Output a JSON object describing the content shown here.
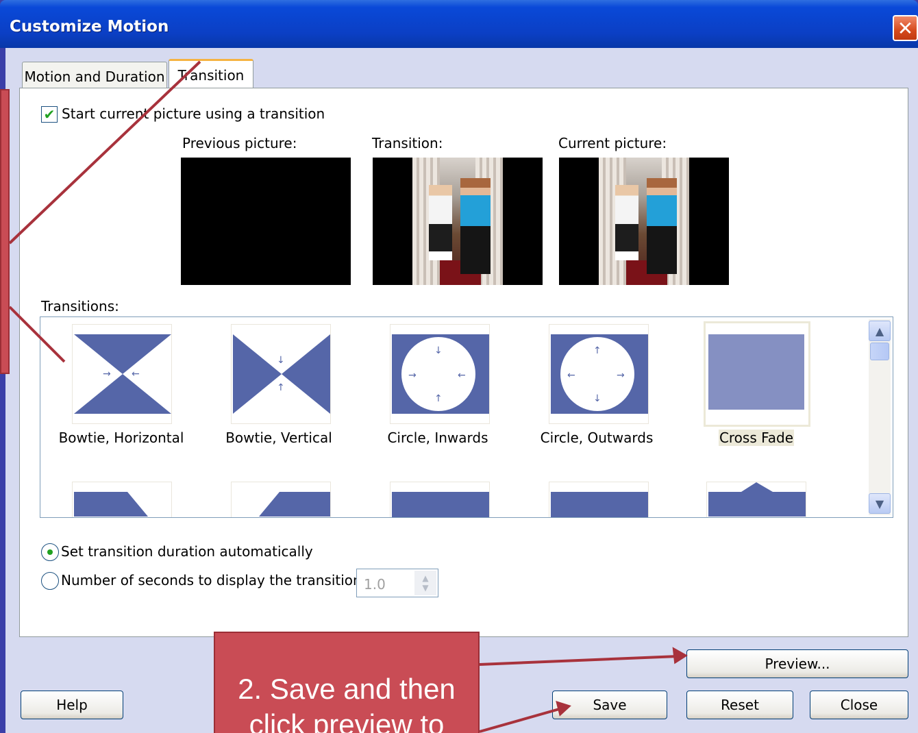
{
  "window": {
    "title": "Customize Motion",
    "close_glyph": "✕"
  },
  "tabs": [
    {
      "label": "Motion and Duration",
      "selected": false
    },
    {
      "label": "Transition",
      "selected": true
    }
  ],
  "transition_panel": {
    "start_checkbox_label": "Start current picture using a transition",
    "start_checkbox_checked": true,
    "previews": {
      "previous_label": "Previous picture:",
      "transition_label": "Transition:",
      "current_label": "Current picture:"
    },
    "transitions_label": "Transitions:",
    "transitions": [
      {
        "label": "Bowtie, Horizontal",
        "icon": "bowtie-horizontal-icon"
      },
      {
        "label": "Bowtie, Vertical",
        "icon": "bowtie-vertical-icon"
      },
      {
        "label": "Circle, Inwards",
        "icon": "circle-inwards-icon"
      },
      {
        "label": "Circle, Outwards",
        "icon": "circle-outwards-icon"
      },
      {
        "label": "Cross Fade",
        "icon": "cross-fade-icon",
        "selected": true
      }
    ],
    "duration": {
      "auto_label": "Set transition duration automatically",
      "auto_selected": true,
      "seconds_label": "Number of seconds to display the transition",
      "seconds_value": "1.0"
    }
  },
  "buttons": {
    "preview": "Preview...",
    "help": "Help",
    "save": "Save",
    "reset": "Reset",
    "close": "Close"
  },
  "annotation": {
    "callout_text_line1": "2. Save and then",
    "callout_text_line2": "click preview to"
  },
  "colors": {
    "titlebar": "#0b3fc4",
    "callout": "#c94c55",
    "accent_blue": "#5566a8",
    "check_green": "#21a121"
  }
}
